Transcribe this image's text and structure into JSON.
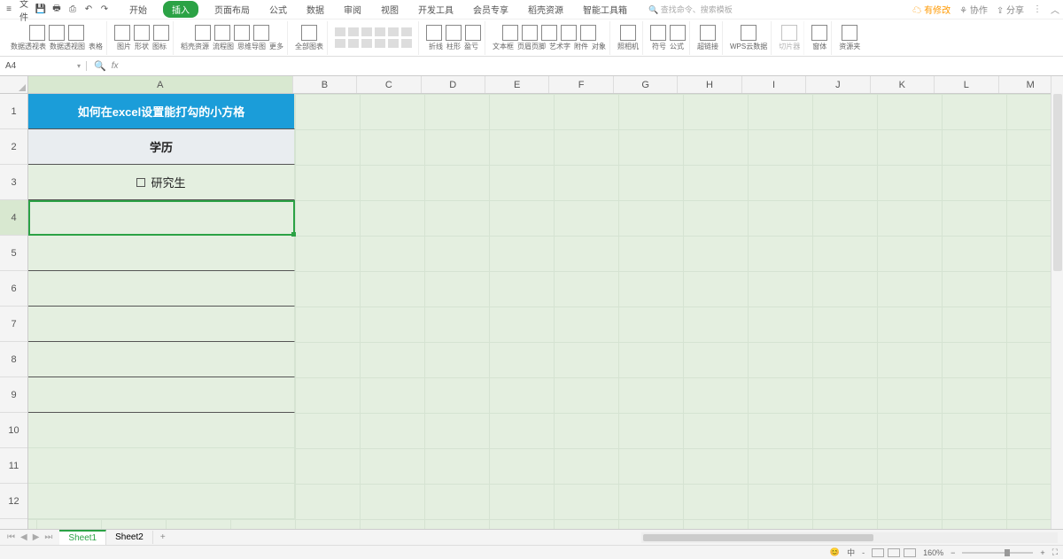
{
  "menu": {
    "file": "文件",
    "tabs": [
      "开始",
      "插入",
      "页面布局",
      "公式",
      "数据",
      "审阅",
      "视图",
      "开发工具",
      "会员专享",
      "稻壳资源",
      "智能工具箱"
    ],
    "active_tab_index": 1,
    "search_placeholder": "查找命令、搜索模板",
    "right": {
      "changes": "有修改",
      "collab": "协作",
      "share": "分享"
    }
  },
  "ribbon": {
    "g1": [
      "数据透视表",
      "数据透视图",
      "表格"
    ],
    "g2": [
      "图片",
      "形状",
      "图标"
    ],
    "g3": [
      "稻壳资源",
      "流程图",
      "思维导图",
      "更多"
    ],
    "g4": "全部图表",
    "g5": [
      "折线",
      "柱形",
      "盈亏"
    ],
    "g6": [
      "文本框",
      "页眉页脚",
      "艺术字",
      "附件",
      "对象"
    ],
    "g7": "照相机",
    "g8": [
      "符号",
      "公式"
    ],
    "g9": "超链接",
    "g10": "WPS云数据",
    "g11": "切片器",
    "g12": "窗体",
    "g13": "资源夹"
  },
  "namebox": {
    "value": "A4"
  },
  "fx": {
    "label": "fx"
  },
  "columns": [
    "A",
    "B",
    "C",
    "D",
    "E",
    "F",
    "G",
    "H",
    "I",
    "J",
    "K",
    "L",
    "M"
  ],
  "rows": [
    "1",
    "2",
    "3",
    "4",
    "5",
    "6",
    "7",
    "8",
    "9",
    "10",
    "11",
    "12"
  ],
  "active_cell": "A4",
  "cell_data": {
    "A1": "如何在excel设置能打勾的小方格",
    "A2": "学历",
    "A3": "研究生"
  },
  "sheets": {
    "tabs": [
      "Sheet1",
      "Sheet2"
    ],
    "active": 0
  },
  "status": {
    "ime": "中",
    "zoom": "160%",
    "minus": "−",
    "plus": "+"
  }
}
